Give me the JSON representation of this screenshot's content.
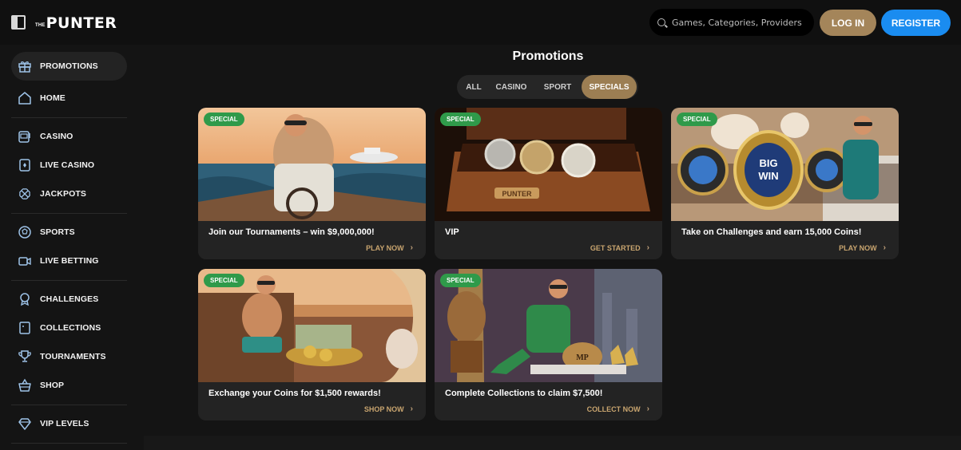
{
  "header": {
    "logo_small": "THE",
    "logo_main": "PUNTER",
    "search_placeholder": "Games, Categories, Providers",
    "login_label": "LOG IN",
    "register_label": "REGISTER"
  },
  "sidebar": {
    "items": [
      {
        "label": "PROMOTIONS",
        "icon": "gift-icon",
        "active": true
      },
      {
        "label": "HOME",
        "icon": "home-icon"
      },
      {
        "label": "CASINO",
        "icon": "slot-machine-icon"
      },
      {
        "label": "LIVE CASINO",
        "icon": "playing-card-icon"
      },
      {
        "label": "JACKPOTS",
        "icon": "clover-icon"
      },
      {
        "label": "SPORTS",
        "icon": "ball-icon"
      },
      {
        "label": "LIVE BETTING",
        "icon": "video-camera-icon"
      },
      {
        "label": "CHALLENGES",
        "icon": "medal-icon"
      },
      {
        "label": "COLLECTIONS",
        "icon": "collection-card-icon"
      },
      {
        "label": "TOURNAMENTS",
        "icon": "trophy-icon"
      },
      {
        "label": "SHOP",
        "icon": "shopping-basket-icon"
      },
      {
        "label": "VIP LEVELS",
        "icon": "diamond-icon"
      }
    ]
  },
  "main": {
    "title": "Promotions",
    "tabs": [
      {
        "label": "ALL"
      },
      {
        "label": "CASINO"
      },
      {
        "label": "SPORT"
      },
      {
        "label": "SPECIALS",
        "active": true
      }
    ],
    "cards": [
      {
        "badge": "SPECIAL",
        "title": "Join our Tournaments – win $9,000,000!",
        "cta": "PLAY NOW"
      },
      {
        "badge": "SPECIAL",
        "title": "VIP",
        "cta": "GET STARTED"
      },
      {
        "badge": "SPECIAL",
        "title": "Take on Challenges and earn 15,000 Coins!",
        "cta": "PLAY NOW"
      },
      {
        "badge": "SPECIAL",
        "title": "Exchange your Coins for $1,500 rewards!",
        "cta": "SHOP NOW"
      },
      {
        "badge": "SPECIAL",
        "title": "Complete Collections to claim $7,500!",
        "cta": "COLLECT NOW"
      }
    ],
    "image_text": {
      "box_brand": "PUNTER",
      "belt_line1": "BIG",
      "belt_line2": "WIN",
      "bag_monogram": "MP"
    }
  },
  "colors": {
    "accent_gold": "#a4855a",
    "register_blue": "#1a8cf0",
    "badge_green": "#2f9a4a",
    "cta_gold": "#c9a56f"
  }
}
